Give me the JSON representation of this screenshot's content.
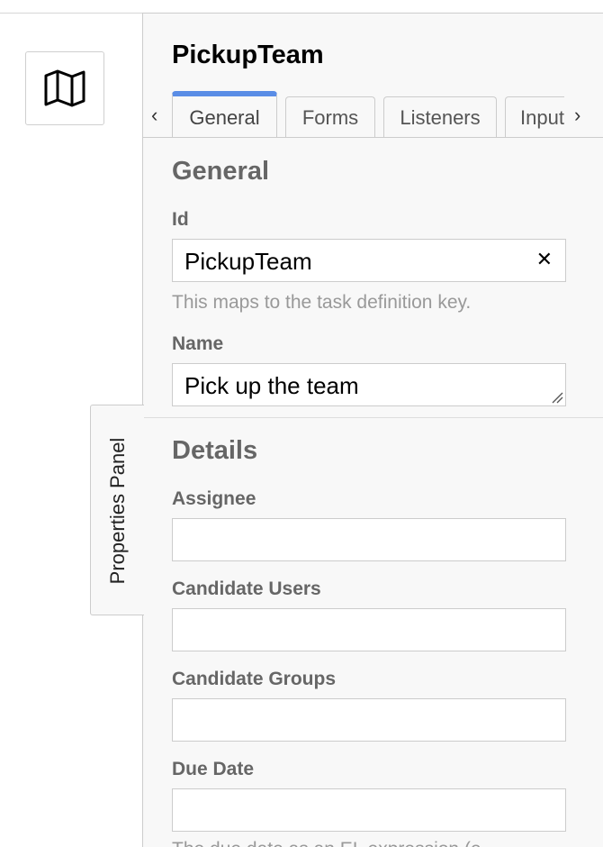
{
  "toolbar": {
    "map_icon": "map-icon"
  },
  "panel_toggle": {
    "label": "Properties Panel"
  },
  "panel": {
    "title": "PickupTeam",
    "tab_prev_icon": "chevron-left-icon",
    "tab_next_icon": "chevron-right-icon",
    "tabs": [
      {
        "label": "General",
        "active": true
      },
      {
        "label": "Forms",
        "active": false
      },
      {
        "label": "Listeners",
        "active": false
      },
      {
        "label": "Input",
        "active": false
      }
    ],
    "general": {
      "title": "General",
      "id_label": "Id",
      "id_value": "PickupTeam",
      "id_hint": "This maps to the task definition key.",
      "name_label": "Name",
      "name_value": "Pick up the team"
    },
    "details": {
      "title": "Details",
      "assignee_label": "Assignee",
      "assignee_value": "",
      "candidate_users_label": "Candidate Users",
      "candidate_users_value": "",
      "candidate_groups_label": "Candidate Groups",
      "candidate_groups_value": "",
      "due_date_label": "Due Date",
      "due_date_value": "",
      "due_date_hint": "The due date as an EL expression (e"
    }
  }
}
